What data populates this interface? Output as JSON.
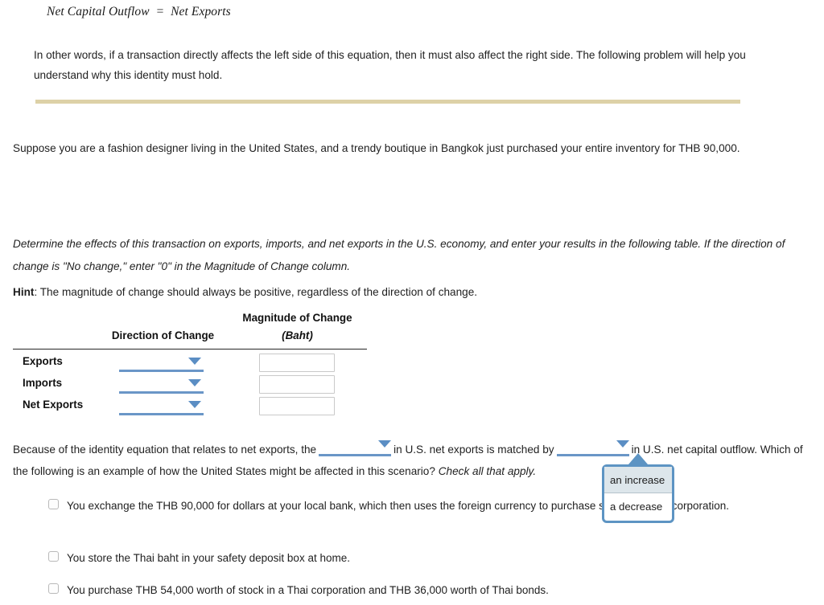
{
  "equation": {
    "text": "Net Capital Outflow  =  Net Exports"
  },
  "intro": {
    "text": "In other words, if a transaction directly affects the left side of this equation, then it must also affect the right side. The following problem will help you understand why this identity must hold."
  },
  "scenario": {
    "text": "Suppose you are a fashion designer living in the United States, and a trendy boutique in Bangkok just purchased your entire inventory for THB 90,000."
  },
  "instructions": {
    "text": "Determine the effects of this transaction on exports, imports, and net exports in the U.S. economy, and enter your results in the following table. If the direction of change is \"No change,\" enter \"0\" in the Magnitude of Change column."
  },
  "hint": {
    "label": "Hint",
    "text": ": The magnitude of change should always be positive, regardless of the direction of change."
  },
  "table": {
    "header_direction": "Direction of Change",
    "header_magnitude_line1": "Magnitude of Change",
    "header_magnitude_line2": "(Baht)",
    "rows": [
      {
        "label": "Exports",
        "direction_value": "",
        "magnitude_value": ""
      },
      {
        "label": "Imports",
        "direction_value": "",
        "magnitude_value": ""
      },
      {
        "label": "Net Exports",
        "direction_value": "",
        "magnitude_value": ""
      }
    ]
  },
  "because": {
    "part1": "Because of the identity equation that relates to net exports, the",
    "dropdown1_value": "",
    "part2": "in U.S. net exports is matched by",
    "dropdown2_value": "",
    "part3": "in U.S. net capital",
    "part4": "outflow. Which of the following is an example of how the United States might be affected in this scenario?",
    "part5": "Check all that apply."
  },
  "popup": {
    "options": [
      {
        "label": "an increase",
        "selected": true
      },
      {
        "label": "a decrease",
        "selected": false
      }
    ]
  },
  "choices": [
    {
      "text": "You exchange the THB 90,000 for dollars at your local bank, which then uses the foreign currency to purchase stock in a Thai corporation.",
      "checked": false
    },
    {
      "text": "You store the Thai baht in your safety deposit box at home.",
      "checked": false
    },
    {
      "text": "You purchase THB 54,000 worth of stock in a Thai corporation and THB 36,000 worth of Thai bonds.",
      "checked": false
    }
  ],
  "colors": {
    "divider": "#ddd1a7",
    "accent_blue": "#5b8ec4",
    "popup_border": "#5d94c3",
    "popup_selected_bg": "#dde6eb"
  }
}
